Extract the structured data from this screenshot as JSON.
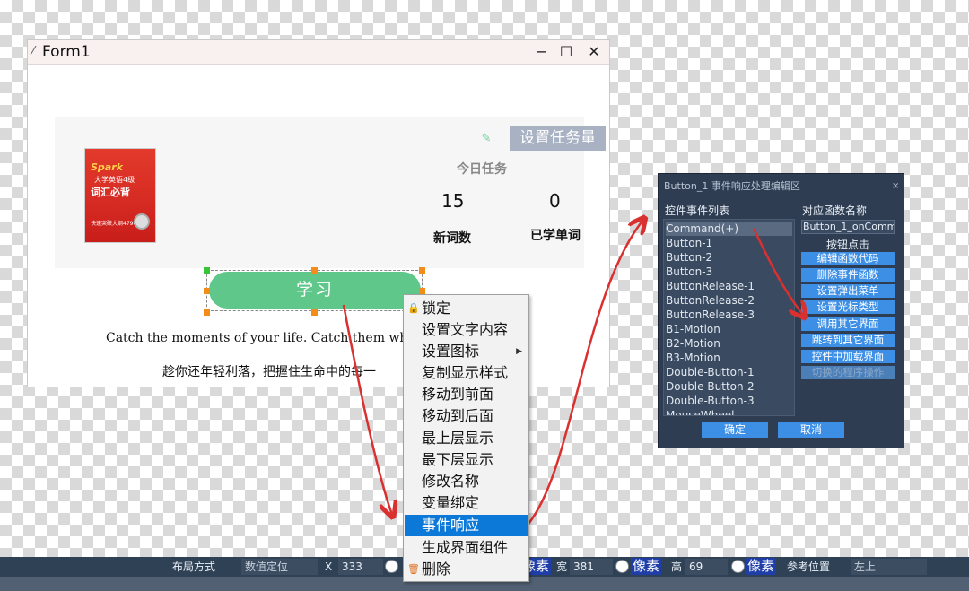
{
  "window": {
    "title": "Form1",
    "minimize": "−",
    "maximize": "☐",
    "close": "✕"
  },
  "card": {
    "book": {
      "brand": "Spark",
      "subtitle": "大学英语4级",
      "title": "词汇必背",
      "footer": "快速突破大纲4790词"
    },
    "set_task_label": "设置任务量",
    "today_label": "今日任务",
    "new_words_count": "15",
    "learned_count": "0",
    "new_words_label": "新词数",
    "learned_label": "已学单词"
  },
  "learn_button_label": "学习",
  "quote": "Catch the moments of your life. Catch them while y",
  "motto": "趁你还年轻利落，把握住生命中的每一",
  "context_menu": {
    "items": [
      {
        "label": "锁定",
        "icon": "lock-icon"
      },
      {
        "label": "设置文字内容"
      },
      {
        "label": "设置图标",
        "submenu": true
      },
      {
        "label": "复制显示样式"
      },
      {
        "label": "移动到前面"
      },
      {
        "label": "移动到后面"
      },
      {
        "label": "最上层显示"
      },
      {
        "label": "最下层显示"
      },
      {
        "label": "修改名称"
      },
      {
        "label": "变量绑定"
      },
      {
        "label": "事件响应",
        "highlighted": true
      },
      {
        "label": "生成界面组件"
      },
      {
        "label": "删除",
        "icon": "trash-icon"
      }
    ]
  },
  "event_dialog": {
    "title": "Button_1 事件响应处理编辑区",
    "close": "×",
    "event_list_label": "控件事件列表",
    "func_name_label": "对应函数名称",
    "events": [
      "Command(+)",
      "Button-1",
      "Button-2",
      "Button-3",
      "ButtonRelease-1",
      "ButtonRelease-2",
      "ButtonRelease-3",
      "B1-Motion",
      "B2-Motion",
      "B3-Motion",
      "Double-Button-1",
      "Double-Button-2",
      "Double-Button-3",
      "MouseWheel"
    ],
    "selected_event": "Command(+)",
    "func_name": "Button_1_onComm",
    "click_label": "按钮点击",
    "actions": [
      "编辑函数代码",
      "删除事件函数",
      "设置弹出菜单",
      "设置光标类型",
      "调用其它界面",
      "跳转到其它界面",
      "控件中加载界面",
      "切换的程序操作"
    ],
    "ok": "确定",
    "cancel": "取消"
  },
  "bottom_bar": {
    "layout_label": "布局方式",
    "layout_value": "数值定位",
    "x_label": "X",
    "x_value": "333",
    "px_unit": "像素",
    "width_label": "宽",
    "width_value": "381",
    "height_label": "高",
    "height_value": "69",
    "ref_label": "参考位置",
    "ref_value": "左上"
  },
  "colors": {
    "learn_button": "#5fc78a",
    "set_task_button": "#a8b2c3",
    "menu_highlight": "#0c79d8",
    "dialog_bg": "#2e3d52",
    "dialog_button": "#3d8fe6",
    "arrow": "#d93030"
  }
}
